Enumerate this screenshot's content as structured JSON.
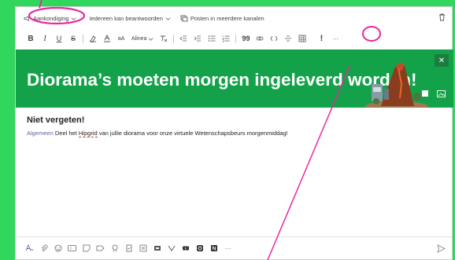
{
  "compose": {
    "announcement_label": "Aankondiging",
    "reply_option": "Iedereen kan beantwoorden",
    "channels_option": "Posten in meerdere kanalen"
  },
  "format": {
    "bold": "B",
    "italic": "I",
    "underline": "U",
    "strike": "S",
    "font_size": "aA",
    "paragraph": "Alinea",
    "quote": "99",
    "important": "!",
    "more": "···"
  },
  "banner": {
    "title": "Diorama’s moeten morgen ingeleverd worden!",
    "color": "#13a24a"
  },
  "message": {
    "subject": "Niet vergeten!",
    "mention": "Algemeen",
    "text_before": " Deel het ",
    "typo_word": "Hipgrid",
    "text_after": " van jullie diorama voor onze virtuele Wetenschapsbeurs morgenmiddag!"
  },
  "bottom_toolbar": {
    "icons": [
      "format-icon",
      "attach-icon",
      "emoji-icon",
      "gif-icon",
      "sticker-icon",
      "meet-icon",
      "praise-icon",
      "approvals-icon",
      "forms-icon",
      "updates-icon",
      "viva-icon",
      "stream-icon",
      "quizlet-icon",
      "onenote-icon",
      "more-icon"
    ],
    "more": "···"
  },
  "colors": {
    "background": "#31d65c",
    "highlight": "#e8299d",
    "accent": "#6264a7"
  }
}
